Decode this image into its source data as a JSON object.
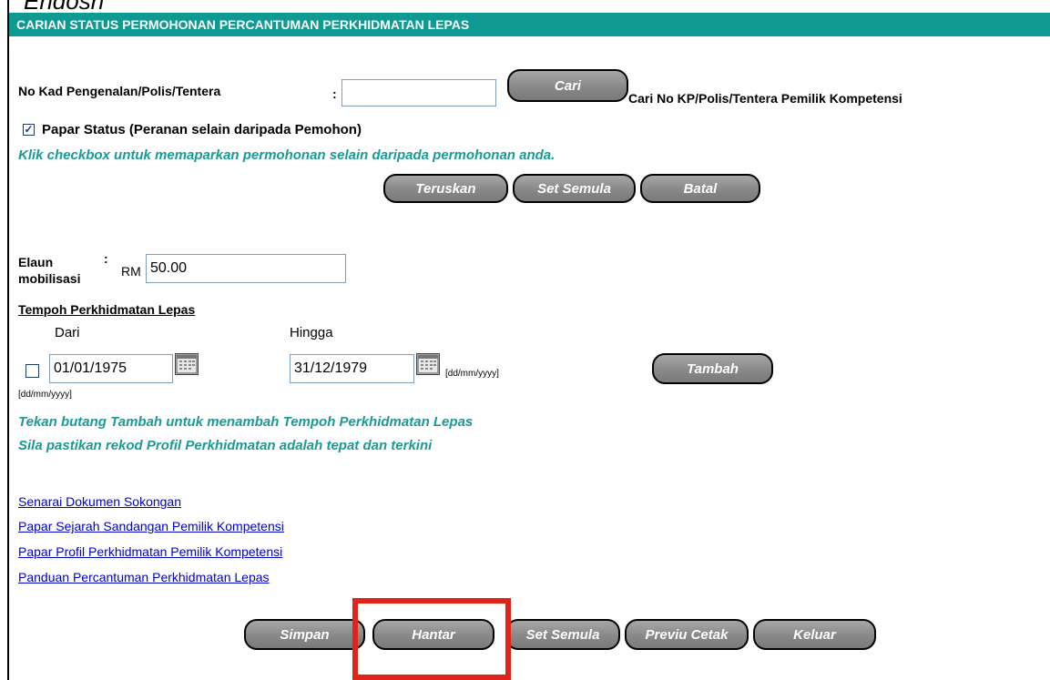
{
  "top_caption": "Endosh",
  "header": {
    "title": "CARIAN STATUS PERMOHONAN PERCANTUMAN PERKHIDMATAN LEPAS"
  },
  "search": {
    "label": "No Kad Pengenalan/Polis/Tentera",
    "colon": ":",
    "value": "",
    "button": "Cari",
    "hint": "Cari No KP/Polis/Tentera Pemilik Kompetensi"
  },
  "status_checkbox": {
    "checked": true,
    "check_glyph": "✓",
    "label": "Papar Status (Peranan selain daripada Pemohon)",
    "note": "Klik checkbox untuk memaparkan permohonan selain daripada permohonan anda."
  },
  "action_buttons": {
    "continue": "Teruskan",
    "reset": "Set Semula",
    "cancel": "Batal"
  },
  "allowance": {
    "label_line1": "Elaun",
    "label_line2": "mobilisasi",
    "colon": ":",
    "currency": "RM",
    "value": "50.00"
  },
  "period": {
    "heading": "Tempoh Perkhidmatan Lepas",
    "from_label": "Dari",
    "to_label": "Hingga",
    "from_value": "01/01/1975",
    "to_value": "31/12/1979",
    "date_format": "[dd/mm/yyyy]",
    "row_checked": false,
    "add_button": "Tambah",
    "note1": "Tekan butang Tambah untuk menambah Tempoh Perkhidmatan Lepas",
    "note2": "Sila pastikan rekod Profil Perkhidmatan adalah tepat dan terkini"
  },
  "links": [
    "Senarai Dokumen Sokongan",
    "Papar Sejarah Sandangan Pemilik Kompetensi",
    "Papar Profil Perkhidmatan Pemilik Kompetensi",
    "Panduan Percantuman Perkhidmatan Lepas"
  ],
  "footer_buttons": {
    "save": "Simpan",
    "submit": "Hantar",
    "reset": "Set Semula",
    "print_preview": "Previu Cetak",
    "exit": "Keluar"
  },
  "colors": {
    "header": "#0e9a92",
    "note_text": "#1a9a94",
    "highlight": "#e2231a"
  }
}
